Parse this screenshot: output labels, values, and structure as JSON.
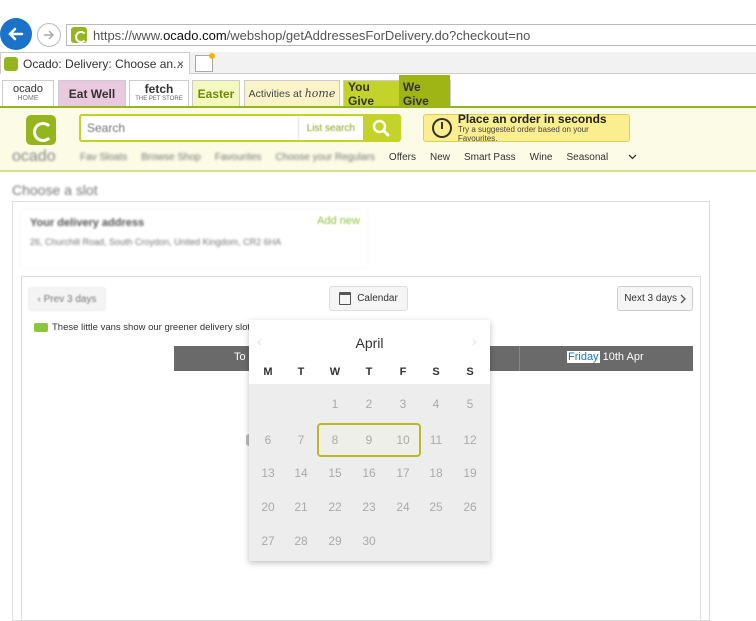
{
  "browser": {
    "url_prefix": "https://www.",
    "url_domain": "ocado.com",
    "url_path": "/webshop/getAddressesForDelivery.do?checkout=no",
    "tab_title": "Ocado: Delivery: Choose an...",
    "tab_close": "×"
  },
  "site_tabs": {
    "home": "ocado",
    "home_sub": "HOME",
    "eat_well": "Eat Well",
    "fetch": "fetch",
    "fetch_sub": "THE PET STORE",
    "easter": "Easter",
    "activities": "Activities at",
    "activities_script": "home",
    "you_give": "You Give",
    "we_give": "We Give"
  },
  "header": {
    "logo": "ocado",
    "search_placeholder": "Search",
    "list_search": "List search",
    "promo_title": "Place an order in seconds",
    "promo_sub": "Try a suggested order based on your Favourites."
  },
  "nav": {
    "items": [
      "Fav Sloats",
      "Browse Shop",
      "Favourites",
      "Choose your Regulars",
      "Offers",
      "New",
      "Smart Pass",
      "Wine",
      "Seasonal"
    ]
  },
  "page": {
    "title": "Choose a slot",
    "address_heading": "Your delivery address",
    "address_line": "26, Churchill Road, South Croydon, United Kingdom, CR2 6HA",
    "add_new": "Add new"
  },
  "slots": {
    "prev_label": "Prev 3 days",
    "calendar_label": "Calendar",
    "next_label": "Next 3 days",
    "vans_note": "These little vans show our greener delivery slots",
    "today_label": "To",
    "friday_word": "Friday",
    "friday_date": "10th Apr"
  },
  "calendar": {
    "month": "April",
    "weekdays": [
      "M",
      "T",
      "W",
      "T",
      "F",
      "S",
      "S"
    ],
    "weeks": [
      [
        "",
        "",
        "1",
        "2",
        "3",
        "4",
        "5"
      ],
      [
        "6",
        "7",
        "8",
        "9",
        "10",
        "11",
        "12"
      ],
      [
        "13",
        "14",
        "15",
        "16",
        "17",
        "18",
        "19"
      ],
      [
        "20",
        "21",
        "22",
        "23",
        "24",
        "25",
        "26"
      ],
      [
        "27",
        "28",
        "29",
        "30",
        "",
        "",
        ""
      ]
    ],
    "selected_range": [
      "8",
      "9",
      "10"
    ]
  },
  "colors": {
    "brand_green": "#95b51e",
    "search_green": "#c3d32a",
    "selection_border": "#b8b82a",
    "day_header": "#6a6a6a"
  }
}
